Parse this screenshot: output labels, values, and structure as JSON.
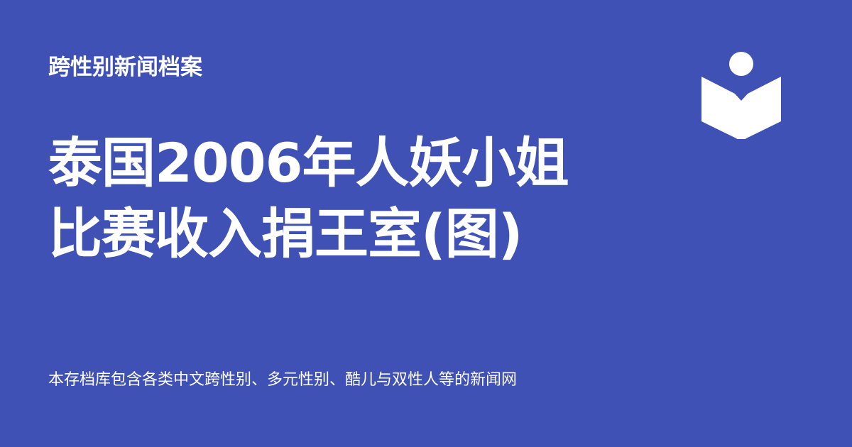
{
  "site": {
    "name": "跨性别新闻档案"
  },
  "article": {
    "title_line_1": "泰国2006年人妖小姐",
    "title_line_2": "比赛收入捐王室(图)"
  },
  "description": "本存档库包含各类中文跨性别、多元性别、酷儿与双性人等的新闻网",
  "logo": {
    "icon": "open-book-person-icon"
  },
  "colors": {
    "background": "#3f51b5",
    "foreground": "#ffffff"
  }
}
